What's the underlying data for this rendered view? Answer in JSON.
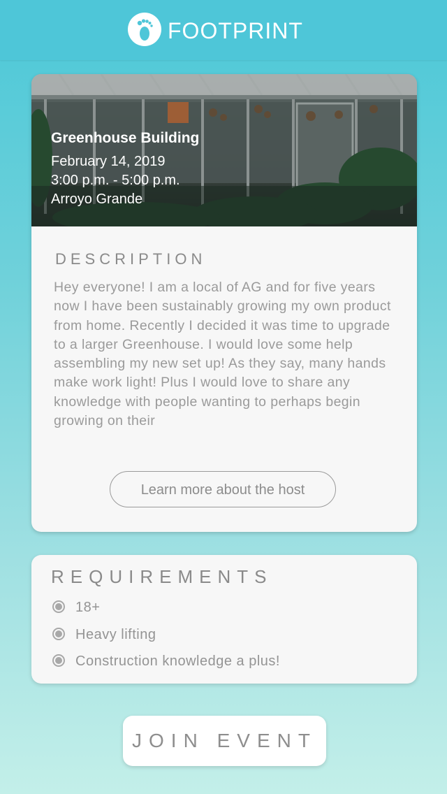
{
  "header": {
    "brand": "FOOTPRINT",
    "logo_icon": "footprint-icon",
    "color": "#4ec6d8"
  },
  "event": {
    "title": "Greenhouse Building",
    "date": "February 14, 2019",
    "time": "3:00 p.m. - 5:00 p.m.",
    "location": "Arroyo Grande",
    "hero_image": "greenhouse-photo"
  },
  "description": {
    "label": "DESCRIPTION",
    "text": "Hey everyone! I am a local of AG and for five years now I have been sustainably growing my own product from home. Recently I decided it was time to upgrade to a larger Greenhouse. I would love some help assembling my new set up! As they say, many hands make work light! Plus I would love to share any knowledge with people wanting to perhaps begin growing on their",
    "host_button": "Learn more about the host"
  },
  "requirements": {
    "label": "REQUIREMENTS",
    "items": [
      "18+",
      "Heavy lifting",
      "Construction knowledge a plus!"
    ]
  },
  "actions": {
    "join": "JOIN EVENT"
  }
}
